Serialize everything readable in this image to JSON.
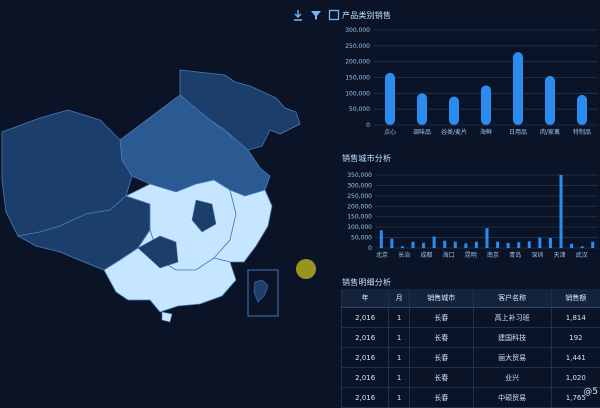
{
  "map": {
    "tools": [
      {
        "name": "download-icon",
        "symbol": "⭳"
      },
      {
        "name": "filter-icon",
        "symbol": "▼"
      },
      {
        "name": "select-box-icon",
        "symbol": "☐"
      }
    ]
  },
  "panels": {
    "category_sales": {
      "title": "产品类别销售",
      "chart_data": {
        "type": "bar",
        "categories": [
          "点心",
          "调味品",
          "谷类/麦片",
          "海鲜",
          "日用品",
          "肉/家禽",
          "特制品"
        ],
        "values": [
          165000,
          100000,
          90000,
          125000,
          230000,
          155000,
          95000
        ],
        "yticks": [
          "300,000",
          "250,000",
          "200,000",
          "150,000",
          "100,000",
          "50,000",
          "0"
        ],
        "ylim": [
          0,
          300000
        ]
      }
    },
    "city_sales": {
      "title": "销售城市分析",
      "chart_data": {
        "type": "bar",
        "categories": [
          "北京",
          "长治",
          "成都",
          "海口",
          "昆明",
          "南京",
          "青岛",
          "深圳",
          "天津",
          "武汉",
          "西安"
        ],
        "labels_shown": [
          "北京",
          "长治",
          "成都",
          "海口",
          "昆明",
          "南京",
          "青岛",
          "深圳",
          "天津",
          "武汉"
        ],
        "values": [
          85000,
          45000,
          8000,
          30000,
          25000,
          55000,
          35000,
          30000,
          22000,
          30000,
          95000,
          30000,
          25000,
          28000,
          32000,
          50000,
          48000,
          350000,
          20000,
          8000,
          30000
        ],
        "yticks": [
          "350,000",
          "300,000",
          "250,000",
          "200,000",
          "150,000",
          "100,000",
          "50,000",
          "0"
        ],
        "ylim": [
          0,
          350000
        ]
      }
    },
    "detail": {
      "title": "销售明细分析",
      "columns": [
        "年",
        "月",
        "销售城市",
        "客户名称",
        "销售额"
      ],
      "rows": [
        [
          "2,016",
          "1",
          "长春",
          "高上补习班",
          "1,814"
        ],
        [
          "2,016",
          "1",
          "长春",
          "建国科技",
          "192"
        ],
        [
          "2,016",
          "1",
          "长春",
          "丽大贸易",
          "1,441"
        ],
        [
          "2,016",
          "1",
          "长春",
          "业兴",
          "1,020"
        ],
        [
          "2,016",
          "1",
          "长春",
          "中硕贸易",
          "1,765"
        ]
      ]
    }
  },
  "watermark": "@5"
}
